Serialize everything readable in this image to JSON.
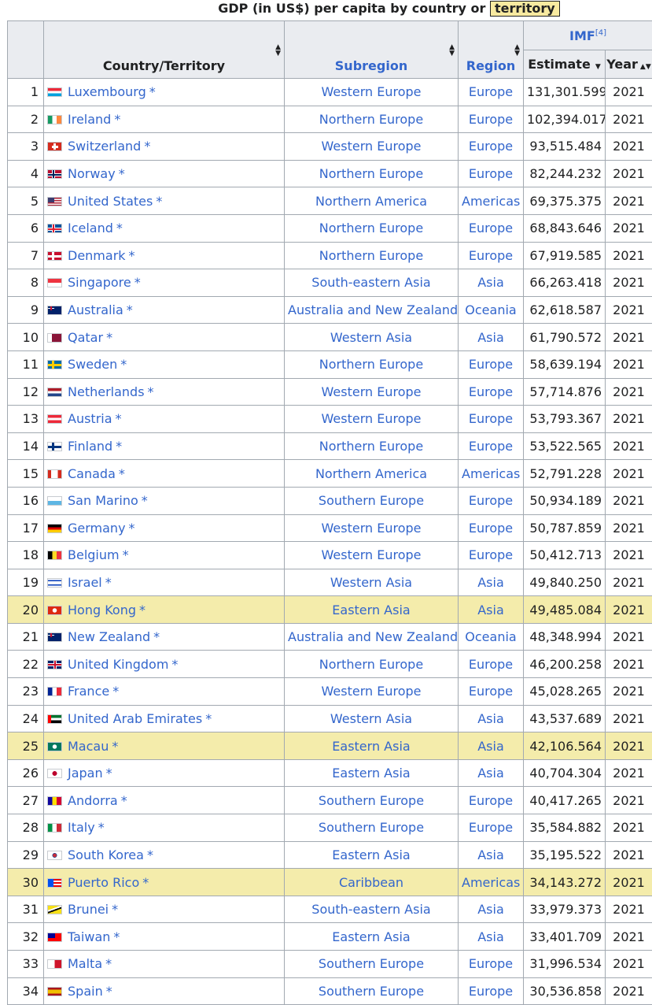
{
  "caption": {
    "text": "GDP (in US$) per capita by country or",
    "territory": "territory"
  },
  "headers": {
    "country": "Country/Territory",
    "subregion": "Subregion",
    "region": "Region",
    "imf": "IMF",
    "imf_ref": "[4]",
    "estimate": "Estimate",
    "year": "Year"
  },
  "colors": {
    "link": "#3366cc",
    "highlight": "#f4ecab",
    "header_bg": "#eaecf0",
    "border": "#a2a9b1"
  },
  "rows": [
    {
      "rank": "1",
      "country": "Luxembourg",
      "star": "*",
      "flag": "luxembourg-flag",
      "subregion": "Western Europe",
      "region": "Europe",
      "estimate": "131,301.599",
      "year": "2021"
    },
    {
      "rank": "2",
      "country": "Ireland",
      "star": "*",
      "flag": "ireland-flag",
      "subregion": "Northern Europe",
      "region": "Europe",
      "estimate": "102,394.017",
      "year": "2021"
    },
    {
      "rank": "3",
      "country": "Switzerland",
      "star": "*",
      "flag": "switzerland-flag",
      "subregion": "Western Europe",
      "region": "Europe",
      "estimate": "93,515.484",
      "year": "2021"
    },
    {
      "rank": "4",
      "country": "Norway",
      "star": "*",
      "flag": "norway-flag",
      "subregion": "Northern Europe",
      "region": "Europe",
      "estimate": "82,244.232",
      "year": "2021"
    },
    {
      "rank": "5",
      "country": "United States",
      "star": "*",
      "flag": "united-states-flag",
      "subregion": "Northern America",
      "region": "Americas",
      "estimate": "69,375.375",
      "year": "2021"
    },
    {
      "rank": "6",
      "country": "Iceland",
      "star": "*",
      "flag": "iceland-flag",
      "subregion": "Northern Europe",
      "region": "Europe",
      "estimate": "68,843.646",
      "year": "2021"
    },
    {
      "rank": "7",
      "country": "Denmark",
      "star": "*",
      "flag": "denmark-flag",
      "subregion": "Northern Europe",
      "region": "Europe",
      "estimate": "67,919.585",
      "year": "2021"
    },
    {
      "rank": "8",
      "country": "Singapore",
      "star": "*",
      "flag": "singapore-flag",
      "subregion": "South-eastern Asia",
      "region": "Asia",
      "estimate": "66,263.418",
      "year": "2021"
    },
    {
      "rank": "9",
      "country": "Australia",
      "star": "*",
      "flag": "australia-flag",
      "subregion": "Australia and New Zealand",
      "region": "Oceania",
      "estimate": "62,618.587",
      "year": "2021"
    },
    {
      "rank": "10",
      "country": "Qatar",
      "star": "*",
      "flag": "qatar-flag",
      "subregion": "Western Asia",
      "region": "Asia",
      "estimate": "61,790.572",
      "year": "2021"
    },
    {
      "rank": "11",
      "country": "Sweden",
      "star": "*",
      "flag": "sweden-flag",
      "subregion": "Northern Europe",
      "region": "Europe",
      "estimate": "58,639.194",
      "year": "2021"
    },
    {
      "rank": "12",
      "country": "Netherlands",
      "star": "*",
      "flag": "netherlands-flag",
      "subregion": "Western Europe",
      "region": "Europe",
      "estimate": "57,714.876",
      "year": "2021"
    },
    {
      "rank": "13",
      "country": "Austria",
      "star": "*",
      "flag": "austria-flag",
      "subregion": "Western Europe",
      "region": "Europe",
      "estimate": "53,793.367",
      "year": "2021"
    },
    {
      "rank": "14",
      "country": "Finland",
      "star": "*",
      "flag": "finland-flag",
      "subregion": "Northern Europe",
      "region": "Europe",
      "estimate": "53,522.565",
      "year": "2021"
    },
    {
      "rank": "15",
      "country": "Canada",
      "star": "*",
      "flag": "canada-flag",
      "subregion": "Northern America",
      "region": "Americas",
      "estimate": "52,791.228",
      "year": "2021"
    },
    {
      "rank": "16",
      "country": "San Marino",
      "star": "*",
      "flag": "san-marino-flag",
      "subregion": "Southern Europe",
      "region": "Europe",
      "estimate": "50,934.189",
      "year": "2021"
    },
    {
      "rank": "17",
      "country": "Germany",
      "star": "*",
      "flag": "germany-flag",
      "subregion": "Western Europe",
      "region": "Europe",
      "estimate": "50,787.859",
      "year": "2021"
    },
    {
      "rank": "18",
      "country": "Belgium",
      "star": "*",
      "flag": "belgium-flag",
      "subregion": "Western Europe",
      "region": "Europe",
      "estimate": "50,412.713",
      "year": "2021"
    },
    {
      "rank": "19",
      "country": "Israel",
      "star": "*",
      "flag": "israel-flag",
      "subregion": "Western Asia",
      "region": "Asia",
      "estimate": "49,840.250",
      "year": "2021"
    },
    {
      "rank": "20",
      "country": "Hong Kong",
      "star": "*",
      "flag": "hong-kong-flag",
      "subregion": "Eastern Asia",
      "region": "Asia",
      "estimate": "49,485.084",
      "year": "2021",
      "highlight": true
    },
    {
      "rank": "21",
      "country": "New Zealand",
      "star": "*",
      "flag": "new-zealand-flag",
      "subregion": "Australia and New Zealand",
      "region": "Oceania",
      "estimate": "48,348.994",
      "year": "2021"
    },
    {
      "rank": "22",
      "country": "United Kingdom",
      "star": "*",
      "flag": "united-kingdom-flag",
      "subregion": "Northern Europe",
      "region": "Europe",
      "estimate": "46,200.258",
      "year": "2021"
    },
    {
      "rank": "23",
      "country": "France",
      "star": "*",
      "flag": "france-flag",
      "subregion": "Western Europe",
      "region": "Europe",
      "estimate": "45,028.265",
      "year": "2021"
    },
    {
      "rank": "24",
      "country": "United Arab Emirates",
      "star": "*",
      "flag": "uae-flag",
      "subregion": "Western Asia",
      "region": "Asia",
      "estimate": "43,537.689",
      "year": "2021"
    },
    {
      "rank": "25",
      "country": "Macau",
      "star": "*",
      "flag": "macau-flag",
      "subregion": "Eastern Asia",
      "region": "Asia",
      "estimate": "42,106.564",
      "year": "2021",
      "highlight": true
    },
    {
      "rank": "26",
      "country": "Japan",
      "star": "*",
      "flag": "japan-flag",
      "subregion": "Eastern Asia",
      "region": "Asia",
      "estimate": "40,704.304",
      "year": "2021"
    },
    {
      "rank": "27",
      "country": "Andorra",
      "star": "*",
      "flag": "andorra-flag",
      "subregion": "Southern Europe",
      "region": "Europe",
      "estimate": "40,417.265",
      "year": "2021"
    },
    {
      "rank": "28",
      "country": "Italy",
      "star": "*",
      "flag": "italy-flag",
      "subregion": "Southern Europe",
      "region": "Europe",
      "estimate": "35,584.882",
      "year": "2021"
    },
    {
      "rank": "29",
      "country": "South Korea",
      "star": "*",
      "flag": "south-korea-flag",
      "subregion": "Eastern Asia",
      "region": "Asia",
      "estimate": "35,195.522",
      "year": "2021"
    },
    {
      "rank": "30",
      "country": "Puerto Rico",
      "star": "*",
      "flag": "puerto-rico-flag",
      "subregion": "Caribbean",
      "region": "Americas",
      "estimate": "34,143.272",
      "year": "2021",
      "highlight": true
    },
    {
      "rank": "31",
      "country": "Brunei",
      "star": "*",
      "flag": "brunei-flag",
      "subregion": "South-eastern Asia",
      "region": "Asia",
      "estimate": "33,979.373",
      "year": "2021"
    },
    {
      "rank": "32",
      "country": "Taiwan",
      "star": "*",
      "flag": "taiwan-flag",
      "subregion": "Eastern Asia",
      "region": "Asia",
      "estimate": "33,401.709",
      "year": "2021"
    },
    {
      "rank": "33",
      "country": "Malta",
      "star": "*",
      "flag": "malta-flag",
      "subregion": "Southern Europe",
      "region": "Europe",
      "estimate": "31,996.534",
      "year": "2021"
    },
    {
      "rank": "34",
      "country": "Spain",
      "star": "*",
      "flag": "spain-flag",
      "subregion": "Southern Europe",
      "region": "Europe",
      "estimate": "30,536.858",
      "year": "2021"
    }
  ]
}
